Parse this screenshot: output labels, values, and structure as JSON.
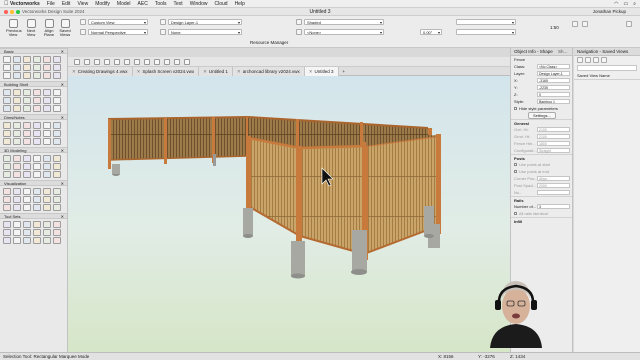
{
  "menubar": {
    "app": "Vectorworks",
    "items": [
      "File",
      "Edit",
      "View",
      "Modify",
      "Model",
      "AEC",
      "Tools",
      "Text",
      "Window",
      "Cloud",
      "Help"
    ]
  },
  "window": {
    "app_title": "Vectorworks Design Suite 2024",
    "doc_title": "Untitled 3",
    "user": "Jonathan Pickup"
  },
  "toolbar": {
    "previous_view": "Previous View",
    "next_view": "Next View",
    "align_plane": "Align Plane",
    "saved_views": "Saved Views",
    "view_dropdown": "Custom View",
    "projection_dropdown": "Normal Perspective",
    "layer_dropdown": "Design Layer-1",
    "class_dropdown": "None",
    "render_dropdown": "Shaded",
    "lighting_dropdown": "<None>",
    "angle_value": "0.00°",
    "scale_value": "1:50",
    "resource_manager": "Resource Manager"
  },
  "palettes": {
    "basic": "Basic",
    "building_shell": "Building Shell",
    "dims_notes": "Dims/Notes",
    "modeling_3d": "3D Modeling",
    "visualization": "Visualization",
    "tool_sets": "Tool Sets"
  },
  "tabs": [
    {
      "label": "Creating Drawings 4.vwx"
    },
    {
      "label": "Splash Screen v2024.vwx"
    },
    {
      "label": "Untitled 1"
    },
    {
      "label": "archoncad library v2024.vwx"
    },
    {
      "label": "Untitled 3"
    }
  ],
  "object_info": {
    "title": "Object Info - Shape",
    "tab_small": "Sh...",
    "object_type": "Fence",
    "class_label": "Class:",
    "class_value": "<No Class>",
    "layer_label": "Layer:",
    "layer_value": "Design Layer-1",
    "x_label": "X:",
    "x_value": "-3165",
    "y_label": "Y:",
    "y_value": "-2235",
    "z_label": "Z:",
    "z_value": "0",
    "style_label": "Style:",
    "style_value": "Bamboo 1",
    "hide_style": "Hide style parameters",
    "settings_button": "Settings...",
    "general_section": "General",
    "gen_rows": [
      "Ovrl. Ht:",
      "Grnd. Ht:",
      "Fence Hei...",
      "Configurati..."
    ],
    "gen_values": [
      "2100",
      "2100",
      "1800",
      "Straight"
    ],
    "posts_section": "Posts",
    "posts_rows": [
      "Use posts at start",
      "Use posts at end",
      "Corner Pos...",
      "Post Spaci...",
      "Nu..."
    ],
    "posts_values": [
      "",
      "",
      "Align...",
      "2000",
      ""
    ],
    "rails_section": "Rails",
    "rails_rows": [
      "Number of...",
      "All rails identical"
    ],
    "rails_values": [
      "3",
      ""
    ],
    "infill_section": "Infill"
  },
  "navigation": {
    "title": "Navigation - Saved Views",
    "column_header": "Saved View Name"
  },
  "status": {
    "tool": "Selection Tool",
    "mode": "Rectangular Marquee Mode",
    "x": "X: 8156",
    "y": "Y: -3276",
    "z": "Z: 1434",
    "length": "L: 14,587 sq m"
  },
  "colors": {
    "wood": "#c77a3c",
    "bamboo": "#c9a56a",
    "concrete": "#a8a8a2",
    "sky": "#d3e5ec",
    "ground": "#d6e6c7"
  }
}
